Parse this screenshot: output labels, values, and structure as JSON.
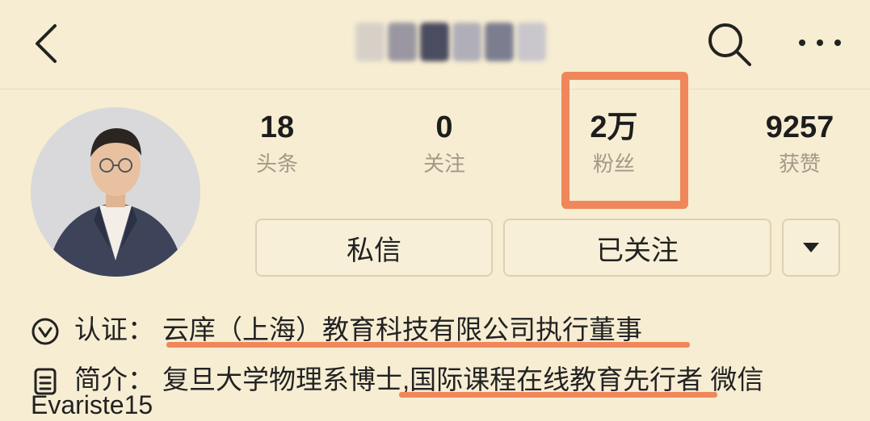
{
  "stats": [
    {
      "value": "18",
      "label": "头条"
    },
    {
      "value": "0",
      "label": "关注"
    },
    {
      "value": "2万",
      "label": "粉丝"
    },
    {
      "value": "9257",
      "label": "获赞"
    }
  ],
  "buttons": {
    "message": "私信",
    "following": "已关注"
  },
  "certification": {
    "label": "认证：",
    "value": "云庠（上海）教育科技有限公司执行董事"
  },
  "intro": {
    "label": "简介：",
    "part1": "复旦大学物理系博士,",
    "part2": "国际课程在线教育先行者",
    "part3": " 微信",
    "line2": "Evariste15"
  },
  "colors": {
    "background": "#f7edd3",
    "highlight": "#f0875a"
  }
}
